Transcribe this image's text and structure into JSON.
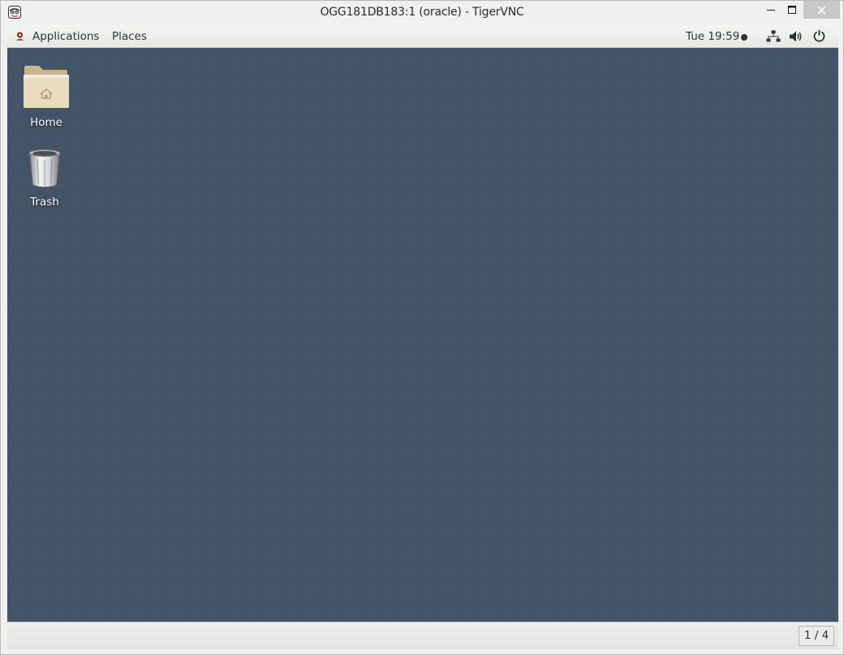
{
  "window": {
    "title": "OGG181DB183:1 (oracle) - TigerVNC",
    "icon": "tigervnc-tiger-icon",
    "controls": {
      "minimize": "minimize-icon",
      "maximize": "maximize-icon",
      "close": "close-icon"
    }
  },
  "panel": {
    "applications_label": "Applications",
    "places_label": "Places",
    "clock": "Tue 19:59",
    "status_icons": [
      "network-icon",
      "volume-icon",
      "power-icon"
    ]
  },
  "desktop": {
    "icons": [
      {
        "label": "Home",
        "icon": "home-folder-icon"
      },
      {
        "label": "Trash",
        "icon": "trash-icon"
      }
    ]
  },
  "bottom_bar": {
    "workspace_indicator": "1 / 4"
  },
  "colors": {
    "desktop_background": "#425365",
    "panel_background": "#eeeeec",
    "close_button_background": "#c7c7c7"
  }
}
